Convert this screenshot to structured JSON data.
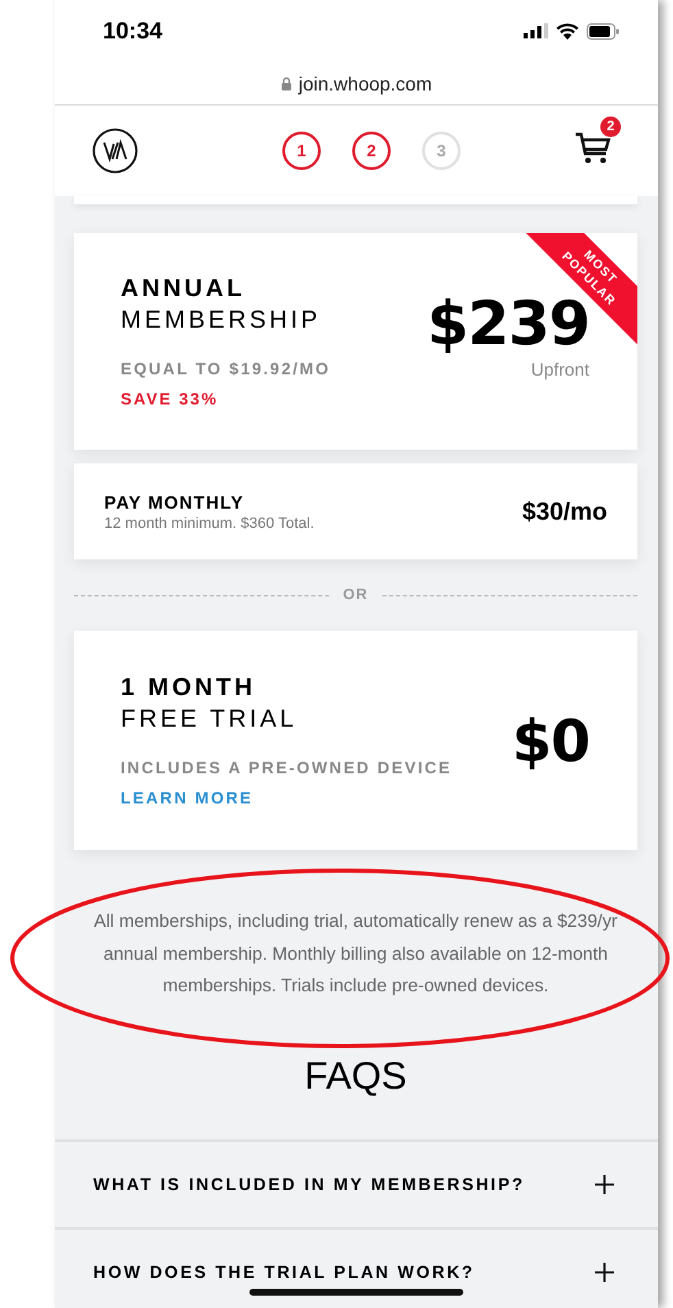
{
  "status_bar": {
    "time": "10:34"
  },
  "browser": {
    "url": "join.whoop.com"
  },
  "steps": [
    {
      "label": "1",
      "active": true
    },
    {
      "label": "2",
      "active": true
    },
    {
      "label": "3",
      "active": false
    }
  ],
  "cart": {
    "badge": "2"
  },
  "annual": {
    "title": "ANNUAL",
    "subtitle": "MEMBERSHIP",
    "equal": "EQUAL TO $19.92/MO",
    "save": "SAVE 33%",
    "price": "$239",
    "price_note": "Upfront",
    "ribbon": [
      "MOST",
      "POPULAR"
    ]
  },
  "monthly": {
    "title": "PAY MONTHLY",
    "note": "12 month minimum. $360 Total.",
    "price": "$30/mo"
  },
  "divider": "OR",
  "trial": {
    "title": "1 MONTH",
    "subtitle": "FREE TRIAL",
    "includes": "INCLUDES A PRE-OWNED DEVICE",
    "link": "LEARN MORE",
    "price": "$0"
  },
  "disclaimer": "All memberships, including trial, automatically renew as a $239/yr annual membership. Monthly billing also available on 12-month memberships. Trials include pre-owned devices.",
  "faqs": {
    "title": "FAQS",
    "items": [
      {
        "question": "WHAT IS INCLUDED IN MY MEMBERSHIP?",
        "expanded": false
      },
      {
        "question": "HOW DOES THE TRIAL PLAN WORK?",
        "expanded": false
      }
    ]
  }
}
